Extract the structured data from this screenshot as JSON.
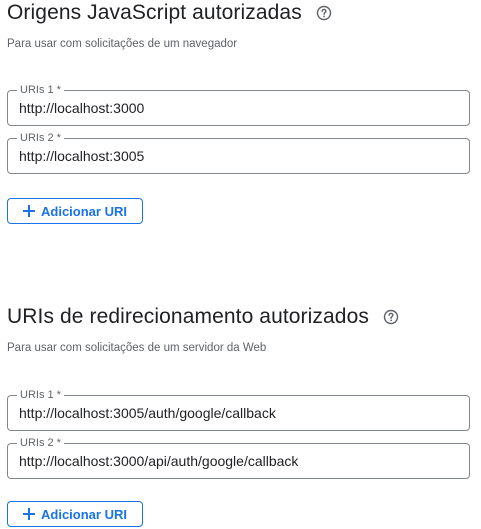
{
  "js_origins": {
    "title": "Origens JavaScript autorizadas",
    "help_icon": "help-circle-icon",
    "subtitle": "Para usar com solicitações de um navegador",
    "fields": [
      {
        "label": "URIs 1 *",
        "value": "http://localhost:3000"
      },
      {
        "label": "URIs 2 *",
        "value": "http://localhost:3005"
      }
    ],
    "add_button_label": "Adicionar URI",
    "add_button_icon": "plus-icon"
  },
  "redirect_uris": {
    "title": "URIs de redirecionamento autorizados",
    "help_icon": "help-circle-icon",
    "subtitle": "Para usar com solicitações de um servidor da Web",
    "fields": [
      {
        "label": "URIs 1 *",
        "value": "http://localhost:3005/auth/google/callback"
      },
      {
        "label": "URIs 2 *",
        "value": "http://localhost:3000/api/auth/google/callback"
      }
    ],
    "add_button_label": "Adicionar URI",
    "add_button_icon": "plus-icon"
  },
  "colors": {
    "accent": "#1a73e8",
    "text": "#202124",
    "secondary_text": "#5f6368",
    "border": "#80868b"
  }
}
